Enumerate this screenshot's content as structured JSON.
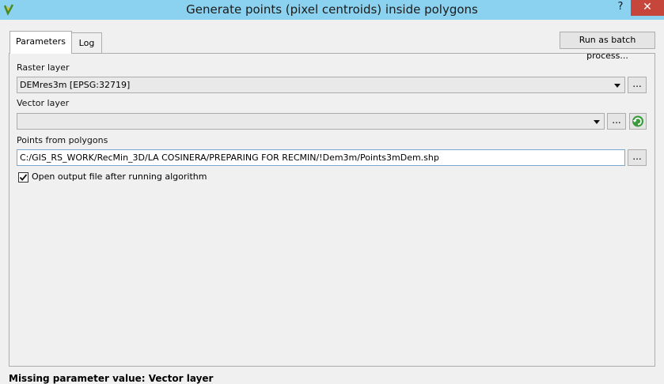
{
  "window": {
    "title": "Generate points (pixel centroids) inside polygons",
    "help_label": "?",
    "close_label": "✕"
  },
  "tabs": [
    {
      "label": "Parameters",
      "active": true
    },
    {
      "label": "Log",
      "active": false
    }
  ],
  "batch_button_label": "Run as batch process...",
  "params": {
    "raster_layer": {
      "label": "Raster layer",
      "value": "DEMres3m [EPSG:32719]",
      "browse_label": "..."
    },
    "vector_layer": {
      "label": "Vector layer",
      "value": "",
      "browse_label": "..."
    },
    "points_from_polygons": {
      "label": "Points from polygons",
      "value": "C:/GIS_RS_WORK/RecMin_3D/LA COSINERA/PREPARING FOR RECMIN/!Dem3m/Points3mDem.shp",
      "browse_label": "..."
    },
    "open_output": {
      "label": "Open output file after running algorithm",
      "checked": true
    }
  },
  "status_message": "Missing parameter value: Vector layer",
  "icons": {
    "app": "qgis-logo-icon",
    "refresh": "refresh-icon",
    "checkmark": "checkmark-icon"
  },
  "colors": {
    "titlebar": "#8ad2f0",
    "close": "#c7463b",
    "refresh_green": "#3b9a3b"
  }
}
